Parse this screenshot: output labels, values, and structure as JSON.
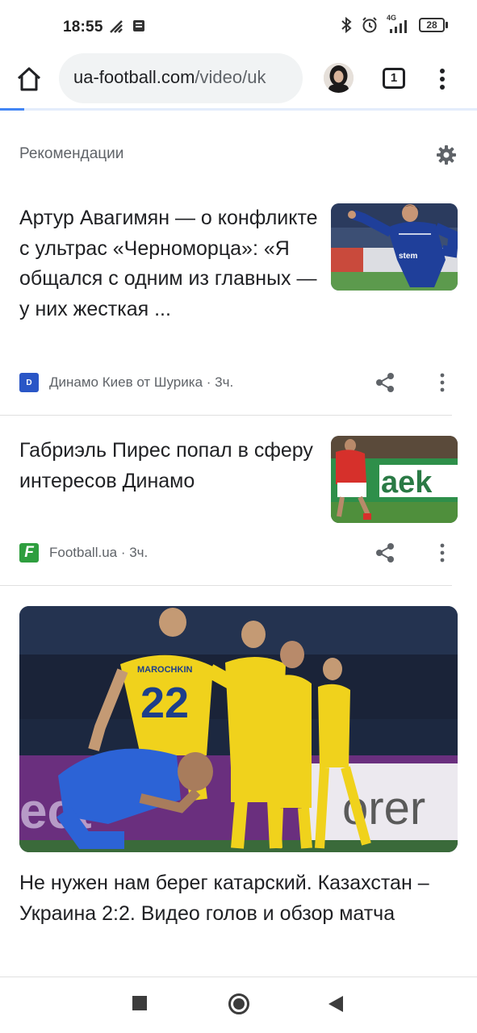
{
  "status_bar": {
    "time": "18:55",
    "network": "4G",
    "battery": "28"
  },
  "browser": {
    "url_domain": "ua-football.com",
    "url_path": "/video/uk",
    "tab_count": "1"
  },
  "feed": {
    "section_title": "Рекомендации",
    "articles": [
      {
        "title": "Артур Авагимян — о конфликте с ультрас «Черноморца»: «Я общался с одним из главных — у них жесткая ...",
        "source_badge": "D",
        "source": "Динамо Киев от Шурика · 3ч."
      },
      {
        "title": "Габриэль Пирес попал в сферу интересов Динамо",
        "source_badge": "F",
        "source": "Football.ua · 3ч."
      },
      {
        "title": "Не нужен нам берег катарский. Казахстан – Украина 2:2. Видео голов и обзор матча"
      }
    ]
  },
  "image_text": {
    "thumb1_board": "stem",
    "thumb2_board": "aek",
    "big_jersey_name": "MAROCHKIN",
    "big_jersey_number": "22",
    "big_board_left": "ect",
    "big_board_right": "orer"
  },
  "colors": {
    "accent": "#4285f4",
    "favicon_dynamo": "#2a56c6",
    "favicon_football": "#2e9e3e",
    "kaz_yellow": "#f5d520",
    "ukr_blue": "#2c63d6"
  }
}
